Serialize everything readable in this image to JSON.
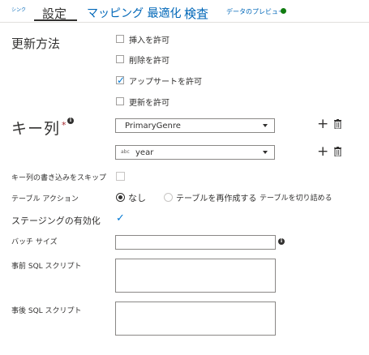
{
  "tabs": {
    "sink": "シンク",
    "settings": "設定",
    "mapping": "マッピング 最適化",
    "inspect": "検査",
    "data_preview": "データのプレビュー"
  },
  "update_method": {
    "label": "更新方法",
    "options": [
      {
        "label": "挿入を許可",
        "checked": false
      },
      {
        "label": "削除を許可",
        "checked": false
      },
      {
        "label": "アップサートを許可",
        "checked": true
      },
      {
        "label": "更新を許可",
        "checked": false
      }
    ]
  },
  "key_columns": {
    "label": "キー列",
    "required_mark": "*",
    "info_icon": "i",
    "rows": [
      {
        "value": "PrimaryGenre",
        "type_badge": ""
      },
      {
        "value": "year",
        "type_badge": "abc"
      }
    ]
  },
  "skip_key_write": {
    "label": "キー列の書き込みをスキップ",
    "checked": false
  },
  "table_action": {
    "label": "テーブル アクション",
    "options": [
      {
        "label": "なし",
        "selected": true
      },
      {
        "label": "テーブルを再作成する",
        "selected": false
      }
    ],
    "truncate_label": "テーブルを切り詰める"
  },
  "staging": {
    "label": "ステージングの有効化",
    "checked": true
  },
  "batch_size": {
    "label": "バッチ サイズ",
    "value": "",
    "info_icon": "i"
  },
  "pre_sql": {
    "label": "事前 SQL スクリプト",
    "value": ""
  },
  "post_sql": {
    "label": "事後 SQL スクリプト",
    "value": ""
  },
  "colors": {
    "accent": "#0067b8",
    "check": "#0078d4",
    "status_dot": "#107c10",
    "required": "#a4262c"
  }
}
